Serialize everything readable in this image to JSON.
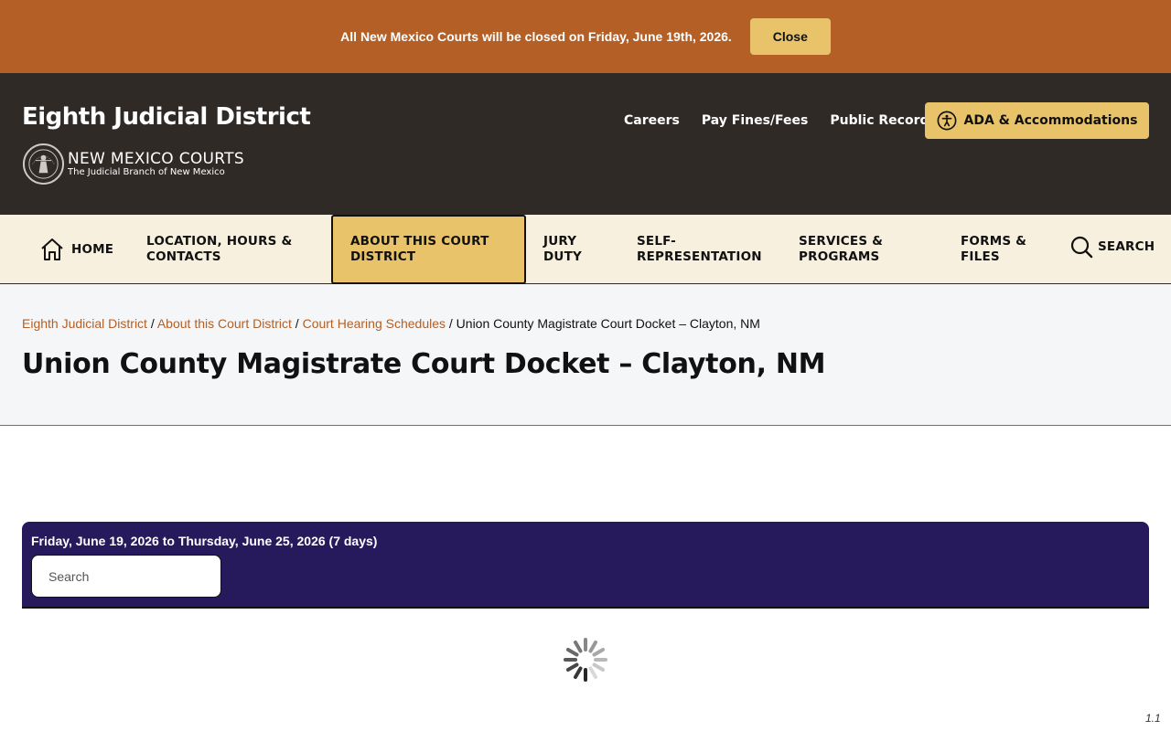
{
  "alert": {
    "message": "All New Mexico Courts will be closed on Friday, June 19th, 2026.",
    "close_label": "Close"
  },
  "header": {
    "site_title": "Eighth Judicial District",
    "logo_main": "NEW MEXICO COURTS",
    "logo_sub": "The Judicial Branch of New Mexico",
    "utility_links": [
      "Careers",
      "Pay Fines/Fees",
      "Public Records"
    ],
    "ada_label": "ADA & Accommodations"
  },
  "nav": {
    "home": "HOME",
    "location": [
      "LOCATION, HOURS &",
      "CONTACTS"
    ],
    "about": [
      "ABOUT THIS COURT",
      "DISTRICT"
    ],
    "jury": [
      "JURY",
      "DUTY"
    ],
    "self_rep": [
      "SELF-",
      "REPRESENTATION"
    ],
    "services": [
      "SERVICES &",
      "PROGRAMS"
    ],
    "forms": [
      "FORMS &",
      "FILES"
    ],
    "search": "SEARCH"
  },
  "breadcrumb": {
    "items": [
      "Eighth Judicial District",
      "About this Court District",
      "Court Hearing Schedules"
    ],
    "separator": " / ",
    "current": "Union County Magistrate Court Docket – Clayton, NM"
  },
  "page_title": "Union County Magistrate Court Docket – Clayton, NM",
  "docket": {
    "date_from": "Friday, June 19, 2026",
    "to_word": "to",
    "date_to": "Thursday, June 25, 2026",
    "days": "(7 days)",
    "search_placeholder": "Search"
  },
  "version": "1.1",
  "colors": {
    "alert_bg": "#b35f25",
    "header_bg": "#302a27",
    "accent_gold": "#e8c36a",
    "nav_bg": "#f8f0de",
    "docket_bg": "#261a5c"
  }
}
